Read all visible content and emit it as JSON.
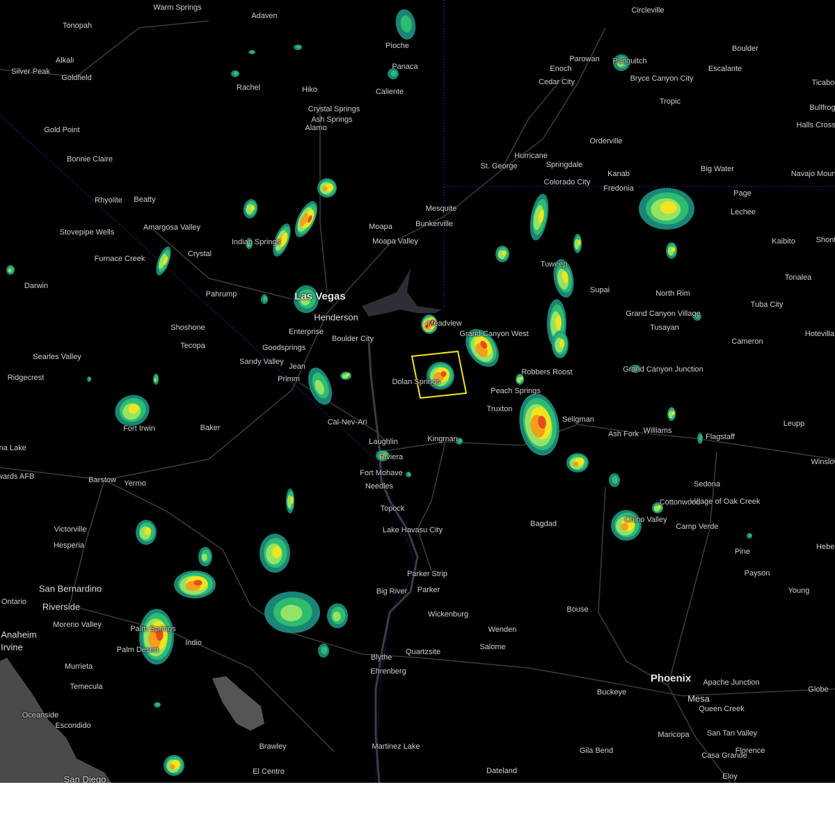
{
  "map": {
    "places": [
      {
        "name": "Warm Springs",
        "size": "s"
      },
      {
        "name": "Adaven",
        "size": "s"
      },
      {
        "name": "Tonopah",
        "size": "s"
      },
      {
        "name": "Pioche",
        "size": "s"
      },
      {
        "name": "Circleville",
        "size": "s"
      },
      {
        "name": "Boulder",
        "size": "s"
      },
      {
        "name": "Alkali",
        "size": "s"
      },
      {
        "name": "Parowan",
        "size": "s"
      },
      {
        "name": "Enoch",
        "size": "s"
      },
      {
        "name": "Panguitch",
        "size": "s"
      },
      {
        "name": "Escalante",
        "size": "s"
      },
      {
        "name": "Silver Peak",
        "size": "s"
      },
      {
        "name": "Panaca",
        "size": "s"
      },
      {
        "name": "Goldfield",
        "size": "s"
      },
      {
        "name": "Cedar City",
        "size": "s"
      },
      {
        "name": "Bryce Canyon City",
        "size": "s"
      },
      {
        "name": "Tropic",
        "size": "s"
      },
      {
        "name": "Ticaboo",
        "size": "s"
      },
      {
        "name": "Rachel",
        "size": "s"
      },
      {
        "name": "Hiko",
        "size": "s"
      },
      {
        "name": "Caliente",
        "size": "s"
      },
      {
        "name": "Bullfrog",
        "size": "s"
      },
      {
        "name": "Crystal Springs",
        "size": "s"
      },
      {
        "name": "Ash Springs",
        "size": "s"
      },
      {
        "name": "Alamo",
        "size": "s"
      },
      {
        "name": "Halls Crossing",
        "size": "s"
      },
      {
        "name": "Gold Point",
        "size": "s"
      },
      {
        "name": "Orderville",
        "size": "s"
      },
      {
        "name": "Bonnie Claire",
        "size": "s"
      },
      {
        "name": "Hurricane",
        "size": "s"
      },
      {
        "name": "St. George",
        "size": "s"
      },
      {
        "name": "Springdale",
        "size": "s"
      },
      {
        "name": "Big Water",
        "size": "s"
      },
      {
        "name": "Navajo Mountain",
        "size": "s"
      },
      {
        "name": "Kanab",
        "size": "s"
      },
      {
        "name": "Colorado City",
        "size": "s"
      },
      {
        "name": "Fredonia",
        "size": "s"
      },
      {
        "name": "Page",
        "size": "s"
      },
      {
        "name": "Rhyolite",
        "size": "s"
      },
      {
        "name": "Beatty",
        "size": "s"
      },
      {
        "name": "Mesquite",
        "size": "s"
      },
      {
        "name": "Lechee",
        "size": "s"
      },
      {
        "name": "Bunkerville",
        "size": "s"
      },
      {
        "name": "Amargosa Valley",
        "size": "s"
      },
      {
        "name": "Moapa",
        "size": "s"
      },
      {
        "name": "Stovepipe Wells",
        "size": "s"
      },
      {
        "name": "Indian Springs",
        "size": "s"
      },
      {
        "name": "Moapa Valley",
        "size": "s"
      },
      {
        "name": "Kaibito",
        "size": "s"
      },
      {
        "name": "Shonto",
        "size": "s"
      },
      {
        "name": "Crystal",
        "size": "s"
      },
      {
        "name": "Furnace Creek",
        "size": "s"
      },
      {
        "name": "Tuweep",
        "size": "s"
      },
      {
        "name": "Tonalea",
        "size": "s"
      },
      {
        "name": "Darwin",
        "size": "s"
      },
      {
        "name": "Supai",
        "size": "s"
      },
      {
        "name": "North Rim",
        "size": "s"
      },
      {
        "name": "Pahrump",
        "size": "s"
      },
      {
        "name": "Las Vegas",
        "size": "l"
      },
      {
        "name": "Grand Canyon Village",
        "size": "s"
      },
      {
        "name": "Tuba City",
        "size": "s"
      },
      {
        "name": "Henderson",
        "size": "m"
      },
      {
        "name": "Meadview",
        "size": "s"
      },
      {
        "name": "Shoshone",
        "size": "s"
      },
      {
        "name": "Tusayan",
        "size": "s"
      },
      {
        "name": "Enterprise",
        "size": "s"
      },
      {
        "name": "Grand Canyon West",
        "size": "s"
      },
      {
        "name": "Hotevilla",
        "size": "s"
      },
      {
        "name": "Boulder City",
        "size": "s"
      },
      {
        "name": "Cameron",
        "size": "s"
      },
      {
        "name": "Tecopa",
        "size": "s"
      },
      {
        "name": "Goodsprings",
        "size": "s"
      },
      {
        "name": "Searles Valley",
        "size": "s"
      },
      {
        "name": "Sandy Valley",
        "size": "s"
      },
      {
        "name": "Jean",
        "size": "s"
      },
      {
        "name": "Grand Canyon Junction",
        "size": "s"
      },
      {
        "name": "Robbers Roost",
        "size": "s"
      },
      {
        "name": "Ridgecrest",
        "size": "s"
      },
      {
        "name": "Primm",
        "size": "s"
      },
      {
        "name": "Dolan Springs",
        "size": "s"
      },
      {
        "name": "Peach Springs",
        "size": "s"
      },
      {
        "name": "Truxton",
        "size": "s"
      },
      {
        "name": "Seligman",
        "size": "s"
      },
      {
        "name": "Leupp",
        "size": "s"
      },
      {
        "name": "Cal-Nev-Ari",
        "size": "s"
      },
      {
        "name": "Fort Irwin",
        "size": "s"
      },
      {
        "name": "Baker",
        "size": "s"
      },
      {
        "name": "Ash Fork",
        "size": "s"
      },
      {
        "name": "Williams",
        "size": "s"
      },
      {
        "name": "Kingman",
        "size": "s"
      },
      {
        "name": "Flagstaff",
        "size": "s"
      },
      {
        "name": "Laughlin",
        "size": "s"
      },
      {
        "name": "China Lake",
        "size": "s"
      },
      {
        "name": "Riviera",
        "size": "s"
      },
      {
        "name": "Winslow",
        "size": "s"
      },
      {
        "name": "Edwards AFB",
        "size": "s"
      },
      {
        "name": "Barstow",
        "size": "s"
      },
      {
        "name": "Yermo",
        "size": "s"
      },
      {
        "name": "Fort Mohave",
        "size": "s"
      },
      {
        "name": "Sedona",
        "size": "s"
      },
      {
        "name": "Needles",
        "size": "s"
      },
      {
        "name": "Village of Oak Creek",
        "size": "s"
      },
      {
        "name": "Cottonwood",
        "size": "s"
      },
      {
        "name": "Topock",
        "size": "s"
      },
      {
        "name": "Chino Valley",
        "size": "s"
      },
      {
        "name": "Bagdad",
        "size": "s"
      },
      {
        "name": "Camp Verde",
        "size": "s"
      },
      {
        "name": "Victorville",
        "size": "s"
      },
      {
        "name": "Lake Havasu City",
        "size": "s"
      },
      {
        "name": "Hesperia",
        "size": "s"
      },
      {
        "name": "Heber",
        "size": "s"
      },
      {
        "name": "Pine",
        "size": "s"
      },
      {
        "name": "Payson",
        "size": "s"
      },
      {
        "name": "Parker Strip",
        "size": "s"
      },
      {
        "name": "San Bernardino",
        "size": "m"
      },
      {
        "name": "Big River",
        "size": "s"
      },
      {
        "name": "Parker",
        "size": "s"
      },
      {
        "name": "Young",
        "size": "s"
      },
      {
        "name": "Ontario",
        "size": "s"
      },
      {
        "name": "Riverside",
        "size": "m"
      },
      {
        "name": "Wickenburg",
        "size": "s"
      },
      {
        "name": "Bouse",
        "size": "s"
      },
      {
        "name": "Moreno Valley",
        "size": "s"
      },
      {
        "name": "Palm Springs",
        "size": "s"
      },
      {
        "name": "Anaheim",
        "size": "m"
      },
      {
        "name": "Wenden",
        "size": "s"
      },
      {
        "name": "Indio",
        "size": "s"
      },
      {
        "name": "Irvine",
        "size": "m"
      },
      {
        "name": "Palm Desert",
        "size": "s"
      },
      {
        "name": "Salome",
        "size": "s"
      },
      {
        "name": "Quartzsite",
        "size": "s"
      },
      {
        "name": "Blythe",
        "size": "s"
      },
      {
        "name": "Phoenix",
        "size": "l"
      },
      {
        "name": "Murrieta",
        "size": "s"
      },
      {
        "name": "Apache Junction",
        "size": "s"
      },
      {
        "name": "Ehrenberg",
        "size": "s"
      },
      {
        "name": "Globe",
        "size": "s"
      },
      {
        "name": "Temecula",
        "size": "s"
      },
      {
        "name": "Buckeye",
        "size": "s"
      },
      {
        "name": "Mesa",
        "size": "m"
      },
      {
        "name": "Queen Creek",
        "size": "s"
      },
      {
        "name": "Oceanside",
        "size": "s"
      },
      {
        "name": "Escondido",
        "size": "s"
      },
      {
        "name": "San Tan Valley",
        "size": "s"
      },
      {
        "name": "Maricopa",
        "size": "s"
      },
      {
        "name": "Martinez Lake",
        "size": "s"
      },
      {
        "name": "Florence",
        "size": "s"
      },
      {
        "name": "Brawley",
        "size": "s"
      },
      {
        "name": "Gila Bend",
        "size": "s"
      },
      {
        "name": "Casa Grande",
        "size": "s"
      },
      {
        "name": "El Centro",
        "size": "s"
      },
      {
        "name": "Dateland",
        "size": "s"
      },
      {
        "name": "San Diego",
        "size": "m"
      },
      {
        "name": "Eloy",
        "size": "s"
      }
    ],
    "warning_box_color": "#f5e51b",
    "radar_colors": [
      "#1e9c8c",
      "#2fbf71",
      "#9be564",
      "#f5e51b",
      "#f59a1b",
      "#e04a1b",
      "#d01b6a"
    ]
  }
}
